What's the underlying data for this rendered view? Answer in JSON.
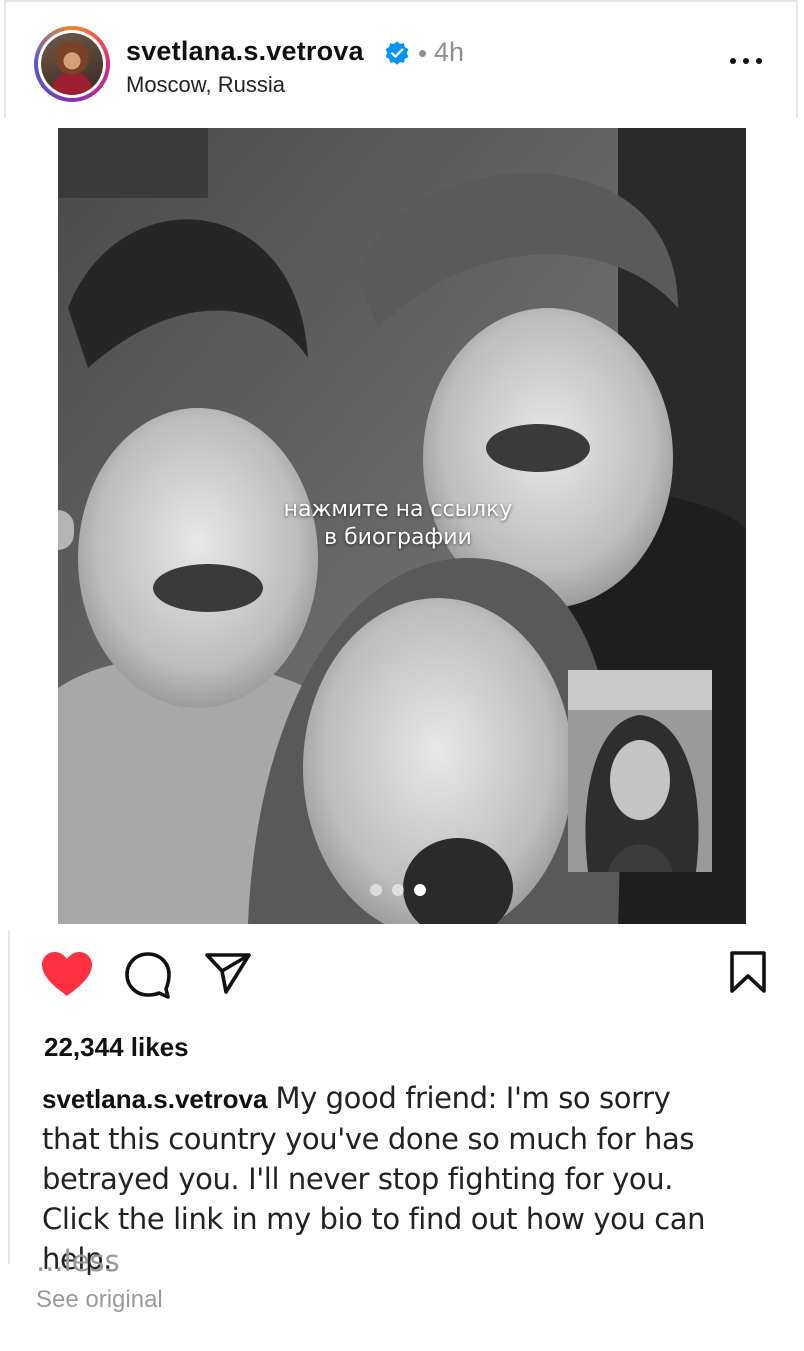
{
  "post": {
    "username": "svetlana.s.vetrova",
    "separator": "•",
    "time_ago": "4h",
    "location": "Moscow, Russia",
    "overlay_text_line1": "нажмите на ссылку",
    "overlay_text_line2": "в биографии",
    "carousel": {
      "total": 3,
      "active_index": 3
    },
    "likes": "22,344 likes",
    "caption_user": "svetlana.s.vetrova",
    "caption_text": "My good friend: I'm so sorry that this country you've done so much for has betrayed you. I'll never stop fighting for you. Click the link in my bio to find out how you can help.",
    "less_label": "...less",
    "see_original_label": "See original"
  },
  "icons": {
    "verified": "verified-badge-icon",
    "more": "more-horizontal-icon",
    "like": "heart-filled-icon",
    "comment": "comment-icon",
    "share": "send-icon",
    "save": "bookmark-icon"
  },
  "colors": {
    "like_red": "#ff3040",
    "verified_blue": "#0095f6",
    "muted_text": "#8e8e8e"
  }
}
